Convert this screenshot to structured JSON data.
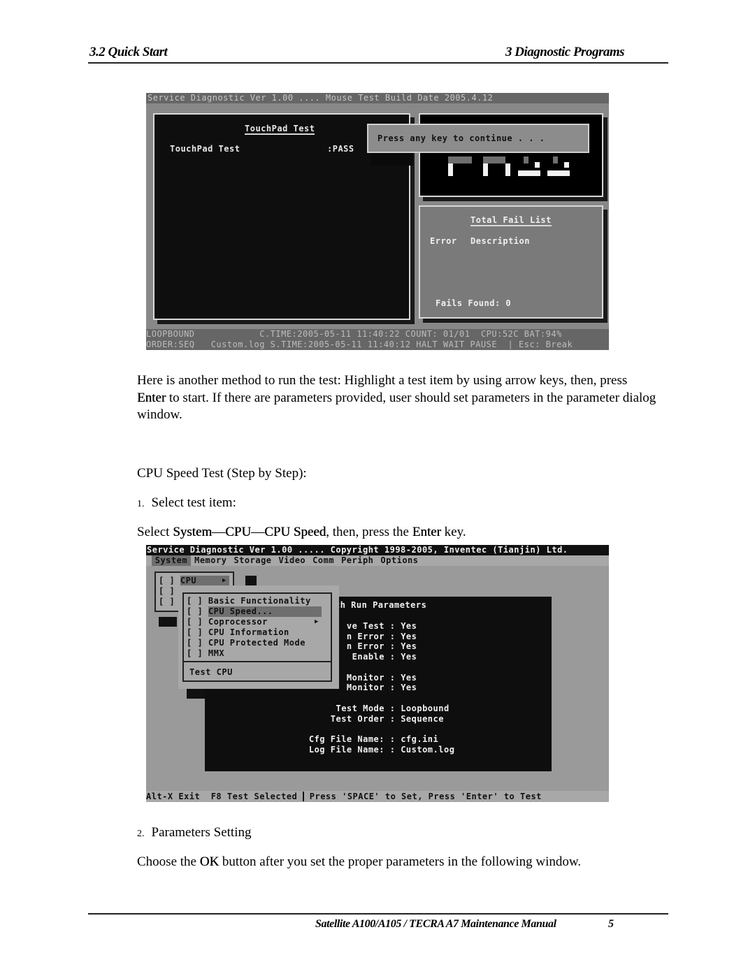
{
  "header": {
    "section": "3.2 Quick Start",
    "chapter": "3  Diagnostic Programs"
  },
  "screen1": {
    "title": "Service Diagnostic Ver 1.00 .... Mouse Test Build Date 2005.4.12",
    "panel_title": "TouchPad Test",
    "result_label": "TouchPad Test",
    "result_value": ":PASS",
    "dialog_text": "Press any key to continue . . .",
    "big_result": "PASS",
    "fail_list": {
      "title": "Total Fail List",
      "col_error": "Error",
      "col_description": "Description",
      "fails_found": "Fails Found: 0"
    },
    "status_line1": "LOOPBOUND            C.TIME:2005-05-11 11:40:22 COUNT: 01/01  CPU:52C BAT:94%",
    "status_line2": "ORDER:SEQ   Custom.log S.TIME:2005-05-11 11:40:12 HALT WAIT PAUSE  | Esc: Break"
  },
  "para1": {
    "before": "Here is another method to run the test: Highlight a test item by using arrow keys, then, press ",
    "key": "Enter",
    "after": " to start. If there are parameters provided, user should set parameters in the parameter dialog window."
  },
  "heading": "CPU Speed Test (Step by Step):",
  "step1": {
    "num": "1.",
    "text": "Select test item:"
  },
  "select_line": {
    "pre": "Select ",
    "path": "System—CPU—CPU Speed",
    "mid": ", then, press the ",
    "key": "Enter",
    "post": " key."
  },
  "screen2": {
    "title": "Service Diagnostic Ver 1.00 ..... Copyright 1998-2005, Inventec (Tianjin) Ltd.",
    "menu": [
      "System",
      "Memory",
      "Storage",
      "Video",
      "Comm",
      "Periph",
      "Options"
    ],
    "selected_menu": "System",
    "system_menu": [
      {
        "check": "[ ]",
        "label": "CPU",
        "submenu": true,
        "selected": true
      },
      {
        "check": "[ ]",
        "label": ""
      },
      {
        "check": "[ ]",
        "label": ""
      }
    ],
    "cpu_menu": [
      {
        "check": "[ ]",
        "label": "Basic Functionality"
      },
      {
        "check": "[ ]",
        "label": "CPU Speed...",
        "selected": true
      },
      {
        "check": "[ ]",
        "label": "Coprocessor",
        "submenu": true
      },
      {
        "check": "[ ]",
        "label": "CPU Information"
      },
      {
        "check": "[ ]",
        "label": "CPU Protected Mode"
      },
      {
        "check": "[ ]",
        "label": "MMX"
      }
    ],
    "cpu_menu_footer": "Test CPU",
    "params_title": "ch Run Parameters",
    "params": [
      {
        "label": "ve Test",
        "value": "Yes"
      },
      {
        "label": "n Error",
        "value": "Yes"
      },
      {
        "label": "n Error",
        "value": "Yes"
      },
      {
        "label": "Enable",
        "value": "Yes"
      },
      {
        "label": "Monitor",
        "value": "Yes"
      },
      {
        "label": "Monitor",
        "value": "Yes"
      }
    ],
    "params2": [
      {
        "label": "Test Mode",
        "value": "Loopbound"
      },
      {
        "label": "Test Order",
        "value": "Sequence"
      },
      {
        "label": "Cfg File Name:",
        "value": "cfg.ini"
      },
      {
        "label": "Log File Name:",
        "value": "Custom.log"
      }
    ],
    "status_left": "Alt-X Exit  F8 Test Selected ",
    "status_right": " Press 'SPACE' to Set, Press 'Enter' to Test"
  },
  "step2": {
    "num": "2.",
    "text": "Parameters Setting"
  },
  "para2": {
    "pre": "Choose the ",
    "key": "OK",
    "post": " button after you set the proper parameters in the following window."
  },
  "footer": {
    "manual": "Satellite A100/A105 / TECRA A7 Maintenance Manual",
    "page": "5"
  }
}
